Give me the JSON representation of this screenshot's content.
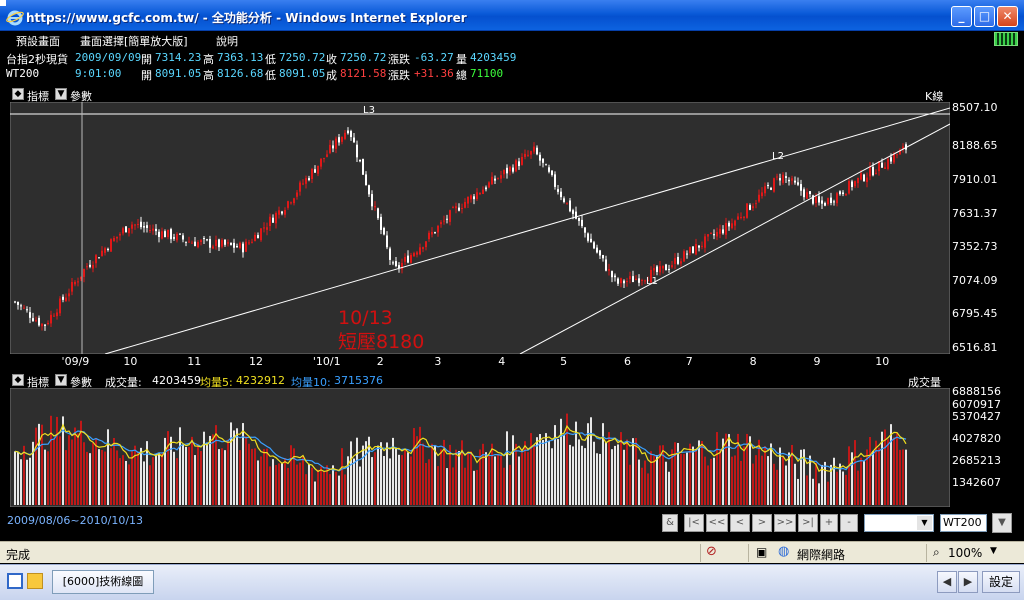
{
  "window": {
    "title": "https://www.gcfc.com.tw/ - 全功能分析 - Windows Internet Explorer"
  },
  "menu": [
    "預設畫面",
    "畫面選擇[簡單放大版]",
    "說明"
  ],
  "quotes": [
    {
      "name": "台指2秒現貨",
      "time": "2009/09/09",
      "open_label": "開",
      "open": "7314.23",
      "high_label": "高",
      "high": "7363.13",
      "low_label": "低",
      "low": "7250.72",
      "close_label": "收",
      "close": "7250.72",
      "change_label": "漲跌",
      "change": "-63.27",
      "volume_label": "量",
      "volume": "4203459"
    },
    {
      "name": "WT200",
      "time": "9:01:00",
      "open_label": "開",
      "open": "8091.05",
      "high_label": "高",
      "high": "8126.68",
      "low_label": "低",
      "low": "8091.05",
      "close_label": "成",
      "close": "8121.58",
      "change_label": "漲跌",
      "change": "+31.36",
      "volume_label": "總",
      "volume": "71100"
    }
  ],
  "price_panel": {
    "indicator_label": "指標",
    "param_label": "參數",
    "panel_title": "K線",
    "y_ticks": [
      "8507.10",
      "8188.65",
      "7910.01",
      "7631.37",
      "7352.73",
      "7074.09",
      "6795.45",
      "6516.81"
    ],
    "x_ticks": [
      "'09/9",
      "10",
      "11",
      "12",
      "'10/1",
      "2",
      "3",
      "4",
      "5",
      "6",
      "7",
      "8",
      "9",
      "10"
    ],
    "annotation_date": "10/13",
    "annotation_text": "短壓8180",
    "pivot_labels": [
      "L3",
      "L2",
      "L1"
    ]
  },
  "volume_panel": {
    "indicator_label": "指標",
    "param_label": "參數",
    "vol_label": "成交量:",
    "vol_value": "4203459",
    "ma5_label": "均量5:",
    "ma5_value": "4232912",
    "ma10_label": "均量10:",
    "ma10_value": "3715376",
    "panel_title": "成交量",
    "y_ticks": [
      "6888156",
      "6070917",
      "5370427",
      "4027820",
      "2685213",
      "1342607"
    ]
  },
  "controls": {
    "date_range": "2009/08/06~2010/10/13",
    "buttons": [
      "&",
      "|<",
      "<<",
      "<",
      ">",
      ">>",
      ">|",
      "+",
      "-"
    ],
    "symbol_value": "WT200"
  },
  "statusbar": {
    "status": "完成",
    "zone": "網際網路",
    "zoom": "100%"
  },
  "taskbar": {
    "item": "[6000]技術線圖",
    "settings": "設定"
  },
  "colors": {
    "up_candle": "#e01818",
    "down_candle": "#ffffff",
    "ma5": "#f0e020",
    "ma10": "#3aa0ff",
    "annotation": "#d01010"
  },
  "chart_data": {
    "type": "candlestick",
    "x_range": [
      "2009/08/06",
      "2010/10/13"
    ],
    "ylim": [
      6516.81,
      8507.1
    ],
    "y_ticks": [
      8507.1,
      8188.65,
      7910.01,
      7631.37,
      7352.73,
      7074.09,
      6795.45,
      6516.81
    ],
    "approx_close_path": [
      {
        "date": "2009/08/06",
        "close": 6900
      },
      {
        "date": "2009/08/20",
        "close": 6700
      },
      {
        "date": "2009/09/10",
        "close": 7200
      },
      {
        "date": "2009/10/01",
        "close": 7550
      },
      {
        "date": "2009/10/30",
        "close": 7400
      },
      {
        "date": "2009/11/25",
        "close": 7350
      },
      {
        "date": "2009/12/15",
        "close": 7700
      },
      {
        "date": "2010/01/15",
        "close": 8350
      },
      {
        "date": "2010/02/06",
        "close": 7150
      },
      {
        "date": "2010/03/10",
        "close": 7700
      },
      {
        "date": "2010/04/15",
        "close": 8150
      },
      {
        "date": "2010/05/25",
        "close": 7050
      },
      {
        "date": "2010/06/15",
        "close": 7150
      },
      {
        "date": "2010/07/20",
        "close": 7550
      },
      {
        "date": "2010/08/13",
        "close": 7950
      },
      {
        "date": "2010/09/01",
        "close": 7700
      },
      {
        "date": "2010/10/13",
        "close": 8180
      }
    ],
    "volume": {
      "ylim": [
        0,
        6888156
      ],
      "last_volume": 4203459,
      "ma5_last": 4232912,
      "ma10_last": 3715376
    }
  }
}
